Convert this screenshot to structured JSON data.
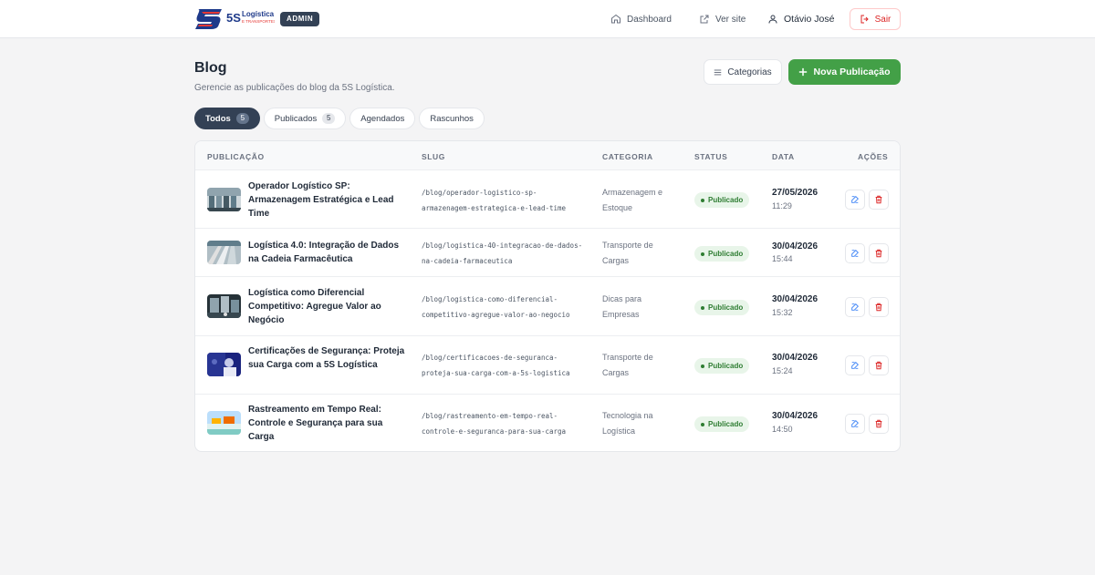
{
  "header": {
    "logo_text": "5S Logística e Transportes",
    "admin_badge": "ADMIN",
    "nav": {
      "dashboard": "Dashboard",
      "site": "Ver site",
      "user": "Otávio José",
      "logout": "Sair"
    }
  },
  "page": {
    "title": "Blog",
    "subtitle": "Gerencie as publicações do blog da 5S Logística.",
    "categories_button": "Categorias",
    "new_button": "Nova Publicação"
  },
  "tabs": [
    {
      "label": "Todos",
      "count": "5",
      "active": true
    },
    {
      "label": "Publicados",
      "count": "5",
      "active": false
    },
    {
      "label": "Agendados",
      "count": "",
      "active": false
    },
    {
      "label": "Rascunhos",
      "count": "",
      "active": false
    }
  ],
  "table": {
    "columns": {
      "publication": "PUBLICAÇÃO",
      "slug": "SLUG",
      "category": "CATEGORIA",
      "status": "STATUS",
      "date": "DATA",
      "actions": "AÇÕES"
    },
    "rows": [
      {
        "title": "Operador Logístico SP: Armazenagem Estratégica e Lead Time",
        "slug": "/blog/operador-logistico-sp-armazenagem-estrategica-e-lead-time",
        "category": "Armazenagem e Estoque",
        "status": "Publicado",
        "date": "27/05/2026",
        "time": "11:29"
      },
      {
        "title": "Logística 4.0: Integração de Dados na Cadeia Farmacêutica",
        "slug": "/blog/logistica-40-integracao-de-dados-na-cadeia-farmaceutica",
        "category": "Transporte de Cargas",
        "status": "Publicado",
        "date": "30/04/2026",
        "time": "15:44"
      },
      {
        "title": "Logística como Diferencial Competitivo: Agregue Valor ao Negócio",
        "slug": "/blog/logistica-como-diferencial-competitivo-agregue-valor-ao-negocio",
        "category": "Dicas para Empresas",
        "status": "Publicado",
        "date": "30/04/2026",
        "time": "15:32"
      },
      {
        "title": "Certificações de Segurança: Proteja sua Carga com a 5S Logística",
        "slug": "/blog/certificacoes-de-seguranca-proteja-sua-carga-com-a-5s-logistica",
        "category": "Transporte de Cargas",
        "status": "Publicado",
        "date": "30/04/2026",
        "time": "15:24"
      },
      {
        "title": "Rastreamento em Tempo Real: Controle e Segurança para sua Carga",
        "slug": "/blog/rastreamento-em-tempo-real-controle-e-seguranca-para-sua-carga",
        "category": "Tecnologia na Logística",
        "status": "Publicado",
        "date": "30/04/2026",
        "time": "14:50"
      }
    ]
  },
  "colors": {
    "primary_dark": "#334155",
    "accent_green": "#43a047",
    "danger": "#dc2626",
    "edit_blue": "#3b82f6"
  },
  "icons": {
    "dashboard": "home-icon",
    "site": "external-link-icon",
    "user": "user-icon",
    "logout": "logout-icon",
    "categories": "list-icon",
    "new": "plus-icon",
    "edit": "edit-icon",
    "delete": "trash-icon"
  }
}
